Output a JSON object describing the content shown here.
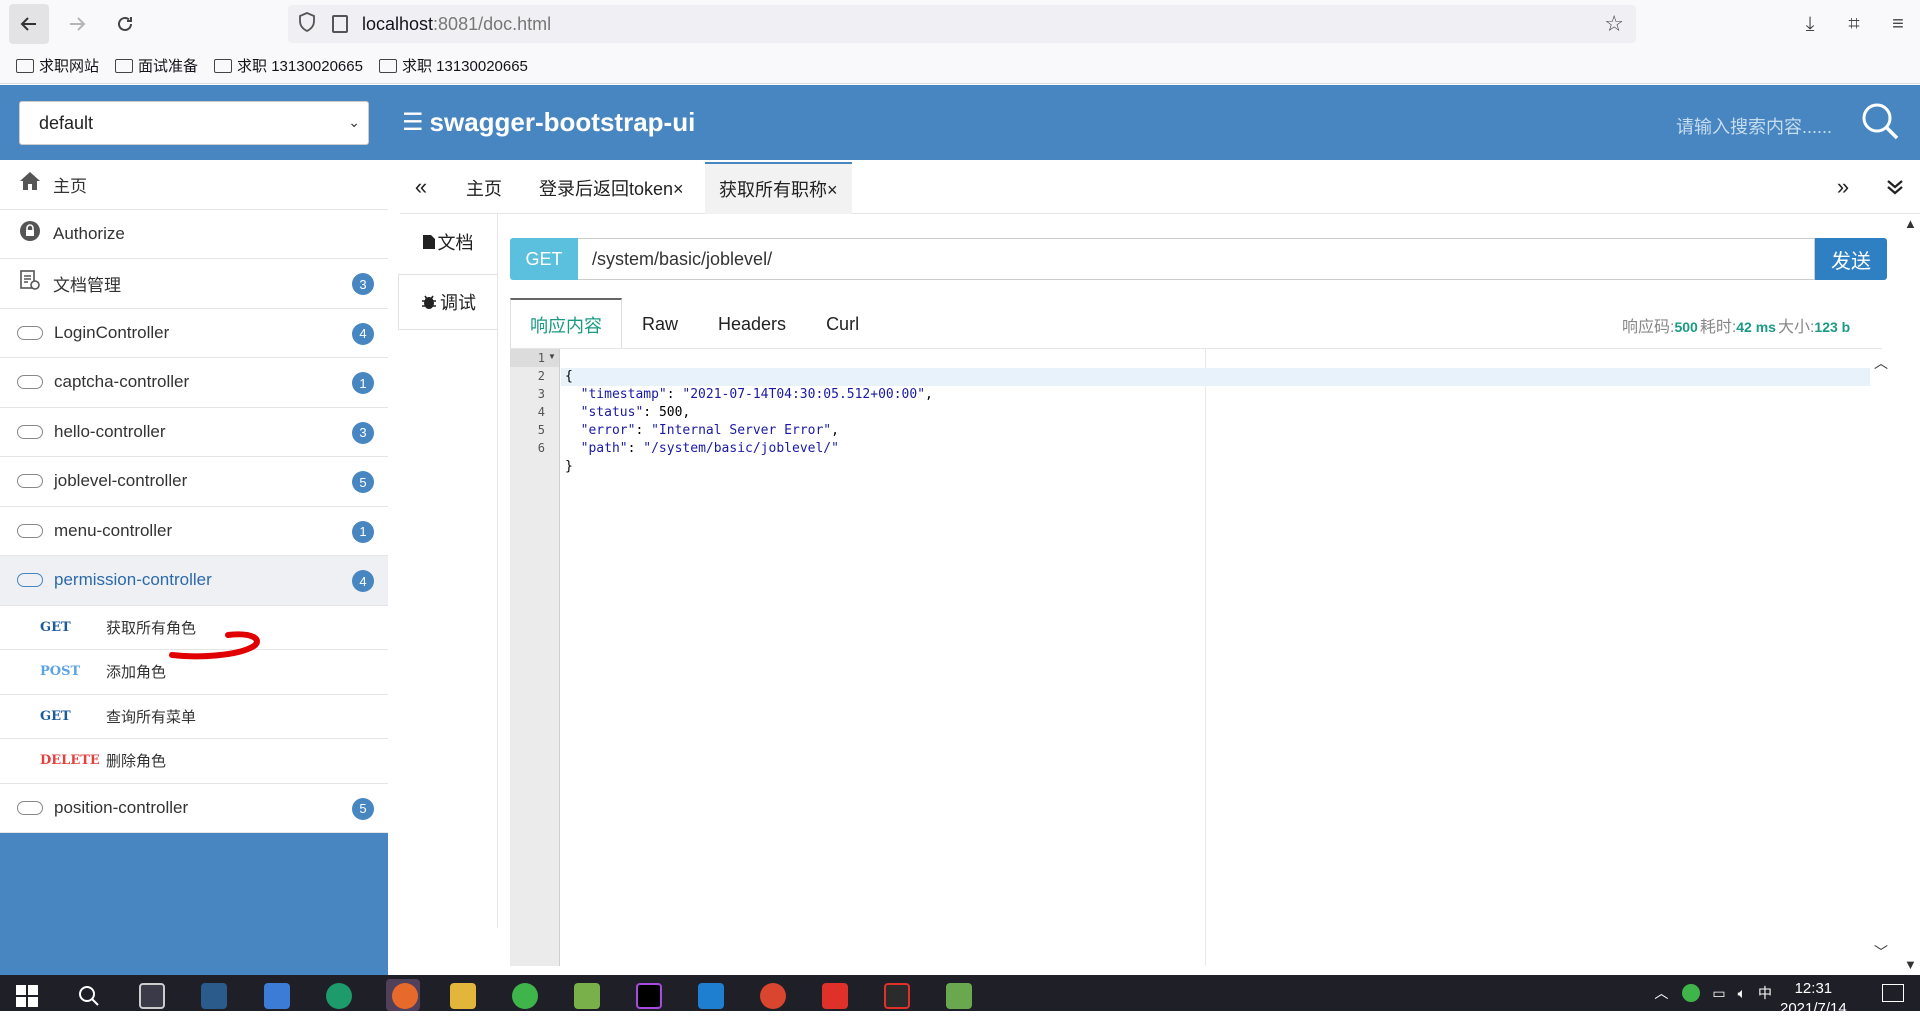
{
  "browser": {
    "url_host": "localhost",
    "url_rest": ":8081/doc.html",
    "bookmarks": [
      "求职网站",
      "面试准备",
      "求职 13130020665",
      "求职 13130020665"
    ]
  },
  "header": {
    "group_select": "default",
    "title": "swagger-bootstrap-ui",
    "search_placeholder": "请输入搜索内容......"
  },
  "sidebar": {
    "items": [
      {
        "label": "主页",
        "badge": ""
      },
      {
        "label": "Authorize",
        "badge": ""
      },
      {
        "label": "文档管理",
        "badge": "3"
      },
      {
        "label": "LoginController",
        "badge": "4"
      },
      {
        "label": "captcha-controller",
        "badge": "1"
      },
      {
        "label": "hello-controller",
        "badge": "3"
      },
      {
        "label": "joblevel-controller",
        "badge": "5"
      },
      {
        "label": "menu-controller",
        "badge": "1"
      },
      {
        "label": "permission-controller",
        "badge": "4"
      }
    ],
    "sub_items": [
      {
        "method": "GET",
        "label": "获取所有角色"
      },
      {
        "method": "POST",
        "label": "添加角色"
      },
      {
        "method": "GET",
        "label": "查询所有菜单"
      },
      {
        "method": "DELETE",
        "label": "删除角色"
      }
    ],
    "last_item": {
      "label": "position-controller",
      "badge": "5"
    }
  },
  "tabs": {
    "items": [
      "主页",
      "登录后返回token×",
      "获取所有职称×"
    ]
  },
  "subnav": {
    "doc": "文档",
    "debug": "调试"
  },
  "request": {
    "method": "GET",
    "path": "/system/basic/joblevel/",
    "send": "发送"
  },
  "response": {
    "tabs": [
      "响应内容",
      "Raw",
      "Headers",
      "Curl"
    ],
    "code_label": "响应码:",
    "code": "500",
    "time_label": "耗时:",
    "time": "42 ms",
    "size_label": "大小:",
    "size": "123 b",
    "line_numbers": [
      "1",
      "2",
      "3",
      "4",
      "5",
      "6"
    ],
    "body": {
      "timestamp_key": "\"timestamp\"",
      "timestamp_val": "\"2021-07-14T04:30:05.512+00:00\"",
      "status_key": "\"status\"",
      "status_val": "500",
      "error_key": "\"error\"",
      "error_val": "\"Internal Server Error\"",
      "path_key": "\"path\"",
      "path_val": "\"/system/basic/joblevel/\""
    }
  },
  "taskbar": {
    "time": "12:31",
    "date": "2021/7/14",
    "ime": "中"
  },
  "colors": {
    "brand": "#4886c1",
    "get": "#5bc0de",
    "send": "#2f7fc3",
    "success": "#1a9a82",
    "delete": "#e53f3f"
  }
}
